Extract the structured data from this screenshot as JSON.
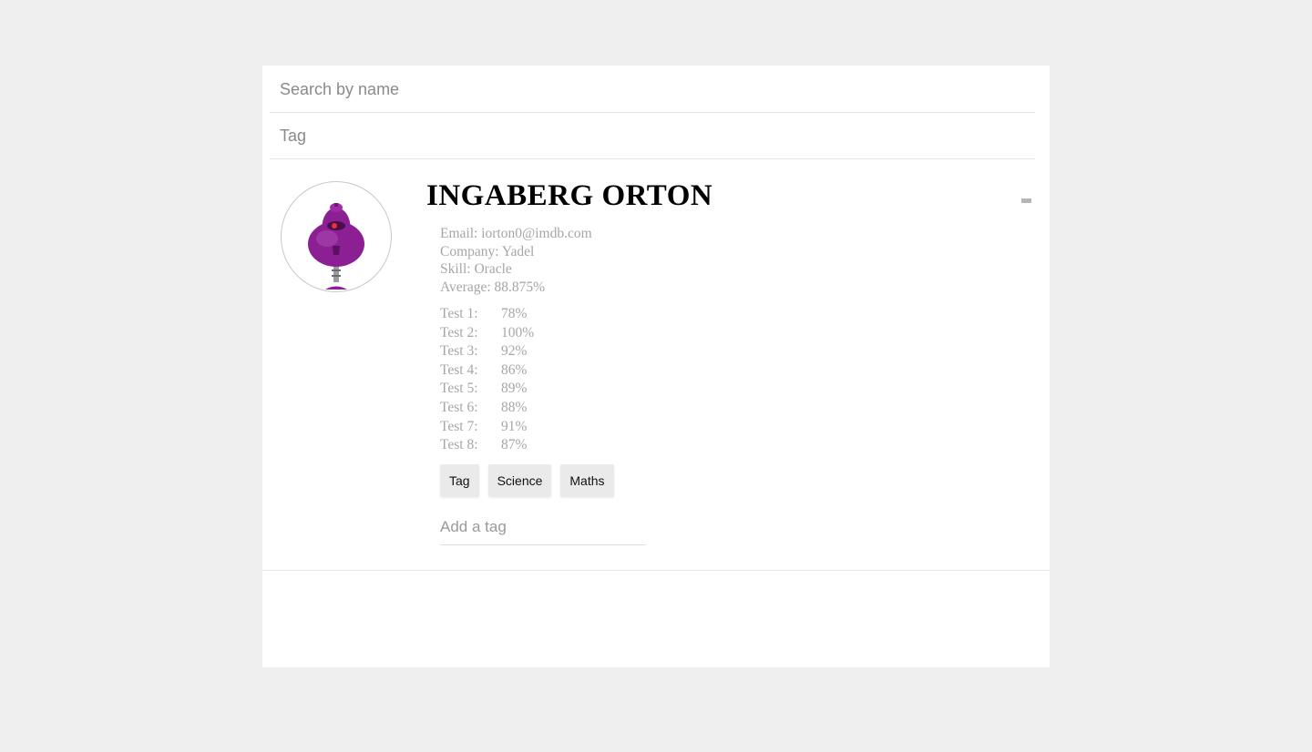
{
  "filters": {
    "search_placeholder": "Search by name",
    "tag_placeholder": "Tag"
  },
  "student": {
    "name": "INGABERG ORTON",
    "avatar_icon": "purple-robot-avatar-icon",
    "toggle_icon": "collapse-minus-icon",
    "details": [
      "Email: iorton0@imdb.com",
      "Company: Yadel",
      "Skill: Oracle",
      "Average: 88.875%"
    ],
    "grades": [
      {
        "label": "Test 1:",
        "value": "78%"
      },
      {
        "label": "Test 2:",
        "value": "100%"
      },
      {
        "label": "Test 3:",
        "value": "92%"
      },
      {
        "label": "Test 4:",
        "value": "86%"
      },
      {
        "label": "Test 5:",
        "value": "89%"
      },
      {
        "label": "Test 6:",
        "value": "88%"
      },
      {
        "label": "Test 7:",
        "value": "91%"
      },
      {
        "label": "Test 8:",
        "value": "87%"
      }
    ],
    "tags": [
      "Tag",
      "Science",
      "Maths"
    ],
    "add_tag_placeholder": "Add a tag"
  },
  "colors": {
    "page_background": "#efefef",
    "panel_background": "#ffffff",
    "detail_text": "#a6a6a6",
    "tag_background": "#eaeaea",
    "avatar_primary": "#8b1f93"
  }
}
